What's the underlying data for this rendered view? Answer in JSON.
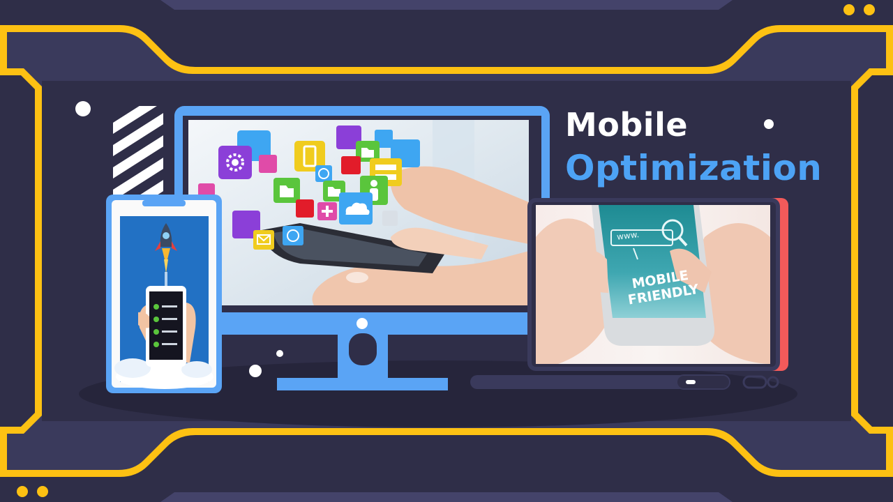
{
  "slide": {
    "title_line1": "Mobile",
    "title_line2": "Optimization"
  },
  "phone_screen": {
    "url_text": "www.",
    "banner_line1": "MOBILE",
    "banner_line2": "FRIENDLY"
  },
  "colors": {
    "background": "#2f2e48",
    "frame_dark": "#3a3a5c",
    "accent_yellow": "#fdc113",
    "accent_blue": "#4da3f5",
    "accent_red": "#f25a5a",
    "title_white": "#ffffff",
    "title_blue": "#4da3f5"
  },
  "icons": [
    "gear-icon",
    "globe-icon",
    "folder-icon",
    "user-icon",
    "plus-icon",
    "cloud-icon",
    "mail-icon",
    "server-icon",
    "phone-icon",
    "rocket-icon",
    "checklist-icon",
    "search-icon"
  ]
}
